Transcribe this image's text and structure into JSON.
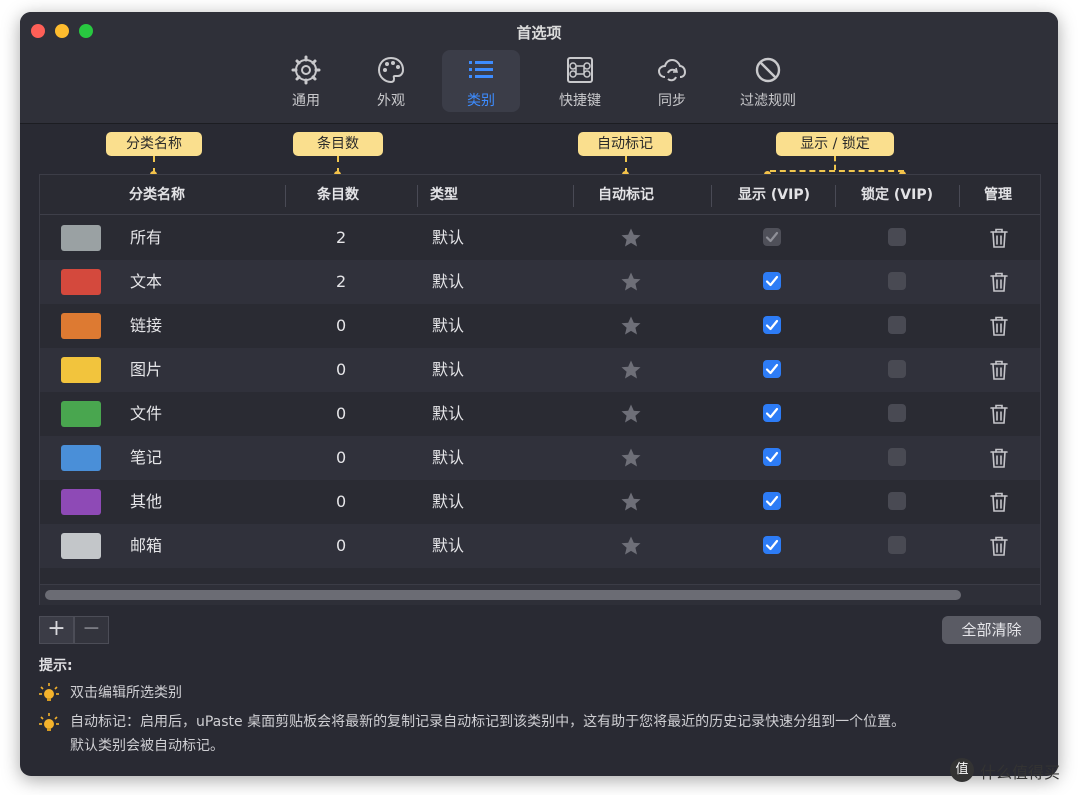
{
  "window": {
    "title": "首选项"
  },
  "tabs": [
    {
      "label": "通用",
      "icon": "gear-icon",
      "active": false
    },
    {
      "label": "外观",
      "icon": "palette-icon",
      "active": false
    },
    {
      "label": "类别",
      "icon": "list-icon",
      "active": true
    },
    {
      "label": "快捷键",
      "icon": "command-key-icon",
      "active": false
    },
    {
      "label": "同步",
      "icon": "cloud-sync-icon",
      "active": false
    },
    {
      "label": "过滤规则",
      "icon": "prohibit-icon",
      "active": false
    }
  ],
  "callouts": {
    "name": "分类名称",
    "count": "条目数",
    "auto_mark": "自动标记",
    "show_lock": "显示 / 锁定"
  },
  "table": {
    "headers": {
      "name": "分类名称",
      "count": "条目数",
      "type": "类型",
      "auto_mark": "自动标记",
      "show": "显示 (VIP)",
      "lock": "锁定 (VIP)",
      "manage": "管理"
    },
    "rows": [
      {
        "color": "#9aa1a3",
        "name": "所有",
        "count": "2",
        "type": "默认",
        "show": "disabled-checked",
        "lock": false
      },
      {
        "color": "#d4493d",
        "name": "文本",
        "count": "2",
        "type": "默认",
        "show": "checked",
        "lock": false
      },
      {
        "color": "#dd7a32",
        "name": "链接",
        "count": "0",
        "type": "默认",
        "show": "checked",
        "lock": false
      },
      {
        "color": "#f2c43d",
        "name": "图片",
        "count": "0",
        "type": "默认",
        "show": "checked",
        "lock": false
      },
      {
        "color": "#49a64f",
        "name": "文件",
        "count": "0",
        "type": "默认",
        "show": "checked",
        "lock": false
      },
      {
        "color": "#4a8fd8",
        "name": "笔记",
        "count": "0",
        "type": "默认",
        "show": "checked",
        "lock": false
      },
      {
        "color": "#8e4ab6",
        "name": "其他",
        "count": "0",
        "type": "默认",
        "show": "checked",
        "lock": false
      },
      {
        "color": "#c3c6c9",
        "name": "邮箱",
        "count": "0",
        "type": "默认",
        "show": "checked",
        "lock": false
      }
    ]
  },
  "buttons": {
    "add": "+",
    "remove": "−",
    "clear_all": "全部清除"
  },
  "hints": {
    "title": "提示:",
    "items": [
      "双击编辑所选类别",
      "自动标记：启用后，uPaste 桌面剪贴板会将最新的复制记录自动标记到该类别中，这有助于您将最近的历史记录快速分组到一个位置。",
      "默认类别会被自动标记。"
    ]
  },
  "watermark": {
    "logo": "值",
    "text": "什么值得买"
  }
}
